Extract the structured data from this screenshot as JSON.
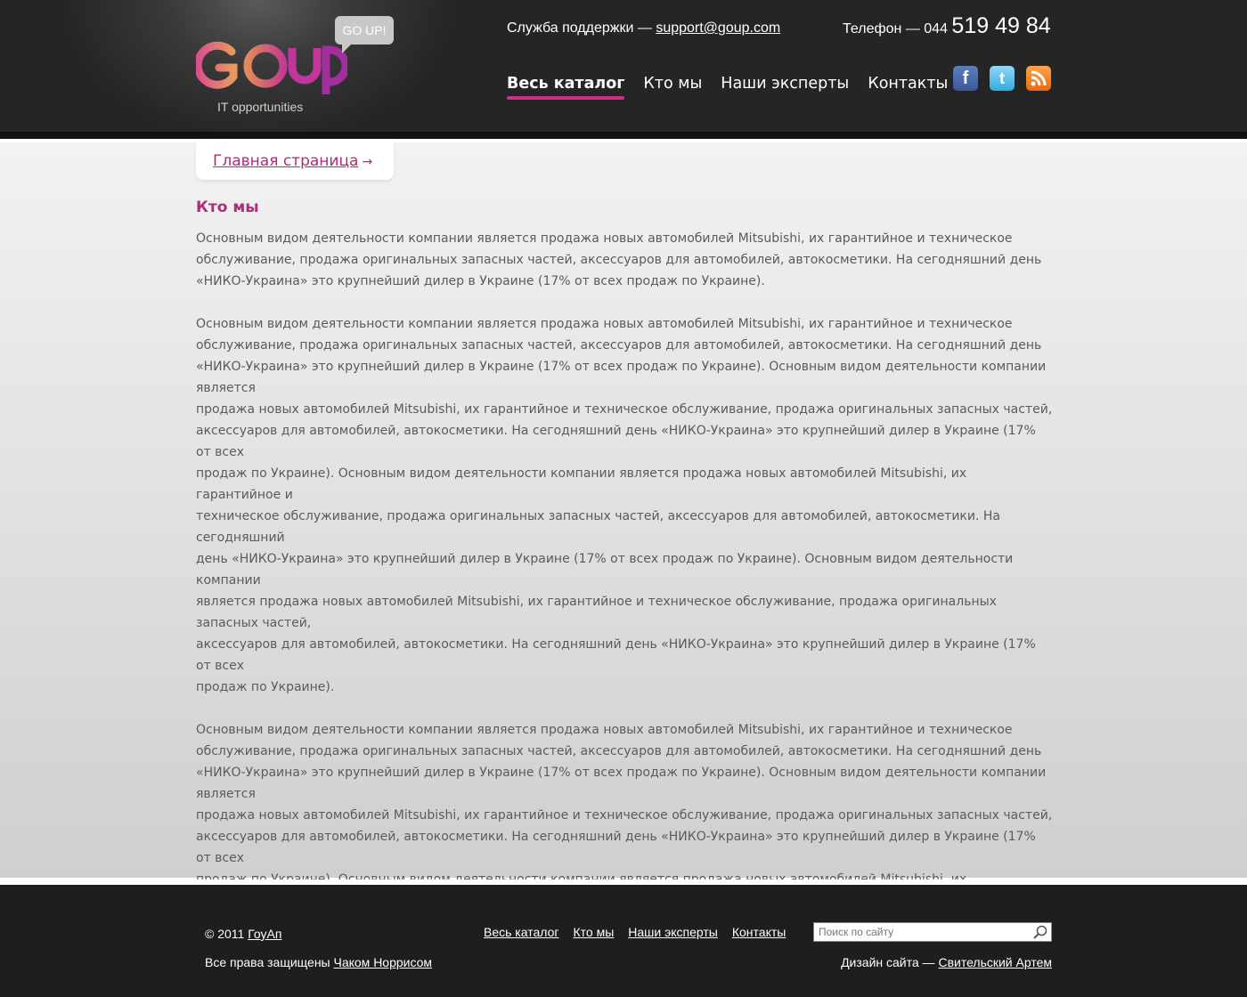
{
  "header": {
    "logo_text": "GOUP",
    "logo_tagline": "IT opportunities",
    "bubble_text": "GO UP!",
    "support_label": "Служба поддержки —",
    "support_email": "support@goup.com",
    "phone_label": "Телефон — 044",
    "phone_number": "519 49 84",
    "nav": [
      {
        "label": "Весь каталог",
        "active": true
      },
      {
        "label": "Кто мы"
      },
      {
        "label": "Наши эксперты"
      },
      {
        "label": "Контакты"
      }
    ],
    "social": [
      {
        "icon": "facebook-icon",
        "glyph": "f",
        "color": "#3b5998"
      },
      {
        "icon": "twitter-icon",
        "glyph": "t",
        "color": "#33aadd"
      },
      {
        "icon": "rss-icon",
        "glyph": "rss",
        "color": "#e76a12"
      }
    ]
  },
  "breadcrumb": {
    "label": "Главная страница",
    "arrow": "→"
  },
  "page": {
    "title": "Кто мы",
    "paragraphs": [
      " Основным видом деятельности компании является продажа новых автомобилей Mitsubishi, их гарантийное и техническое\nобслуживание, продажа оригинальных запасных частей, аксессуаров для автомобилей, автокосметики. На сегодняшний день\n«НИКО-Украина» это крупнейший дилер в Украине (17% от всех продаж по Украине).",
      " Основным видом деятельности компании является продажа новых автомобилей Mitsubishi, их гарантийное и техническое\nобслуживание, продажа оригинальных запасных частей, аксессуаров для автомобилей, автокосметики. На сегодняшний день\n«НИКО-Украина» это крупнейший дилер в Украине (17% от всех продаж по Украине).  Основным видом деятельности компании является\nпродажа новых автомобилей Mitsubishi, их гарантийное и техническое обслуживание, продажа оригинальных запасных частей,\nаксессуаров для автомобилей, автокосметики. На сегодняшний день «НИКО-Украина» это крупнейший дилер в Украине (17% от всех\nпродаж по Украине).  Основным видом деятельности компании является продажа новых автомобилей Mitsubishi, их гарантийное и\nтехническое обслуживание, продажа оригинальных запасных частей, аксессуаров для автомобилей, автокосметики. На сегодняшний\nдень «НИКО-Украина» это крупнейший дилер в Украине (17% от всех продаж по Украине).  Основным видом деятельности компании\nявляется продажа новых автомобилей Mitsubishi, их гарантийное и техническое обслуживание, продажа оригинальных запасных частей,\nаксессуаров для автомобилей, автокосметики. На сегодняшний день «НИКО-Украина» это крупнейший дилер в Украине (17% от всех\nпродаж по Украине).",
      " Основным видом деятельности компании является продажа новых автомобилей Mitsubishi, их гарантийное и техническое\nобслуживание, продажа оригинальных запасных частей, аксессуаров для автомобилей, автокосметики. На сегодняшний день\n«НИКО-Украина» это крупнейший дилер в Украине (17% от всех продаж по Украине).  Основным видом деятельности компании является\nпродажа новых автомобилей Mitsubishi, их гарантийное и техническое обслуживание, продажа оригинальных запасных частей,\nаксессуаров для автомобилей, автокосметики. На сегодняшний день «НИКО-Украина» это крупнейший дилер в Украине (17% от всех\nпродаж по Украине).  Основным видом деятельности компании является продажа новых автомобилей Mitsubishi, их гарантийное и\nтехническое обслуживание, продажа оригинальных запасных частей, аксессуаров для автомобилей, автокосметики. На сегодняшний\nдень «НИКО-Украина» это крупнейший дилер в Украине (17% от всех продаж по Украине).  Основным видом деятельности компании"
    ]
  },
  "footer": {
    "copyright": "© 2011",
    "brand_link": "ГоуАп",
    "rights_text": "Все права защищены",
    "rights_link": "Чаком Норрисом",
    "nav": [
      "Весь каталог",
      "Кто мы",
      "Наши эксперты",
      "Контакты"
    ],
    "search_placeholder": "Поиск по сайту",
    "design_label": "Дизайн сайта —",
    "design_link": "Свительский Артем"
  },
  "colors": {
    "accent": "#cc2f85",
    "link": "#b22a7a",
    "header_bg": "#262626",
    "footer_bg": "#1e1e1e"
  }
}
